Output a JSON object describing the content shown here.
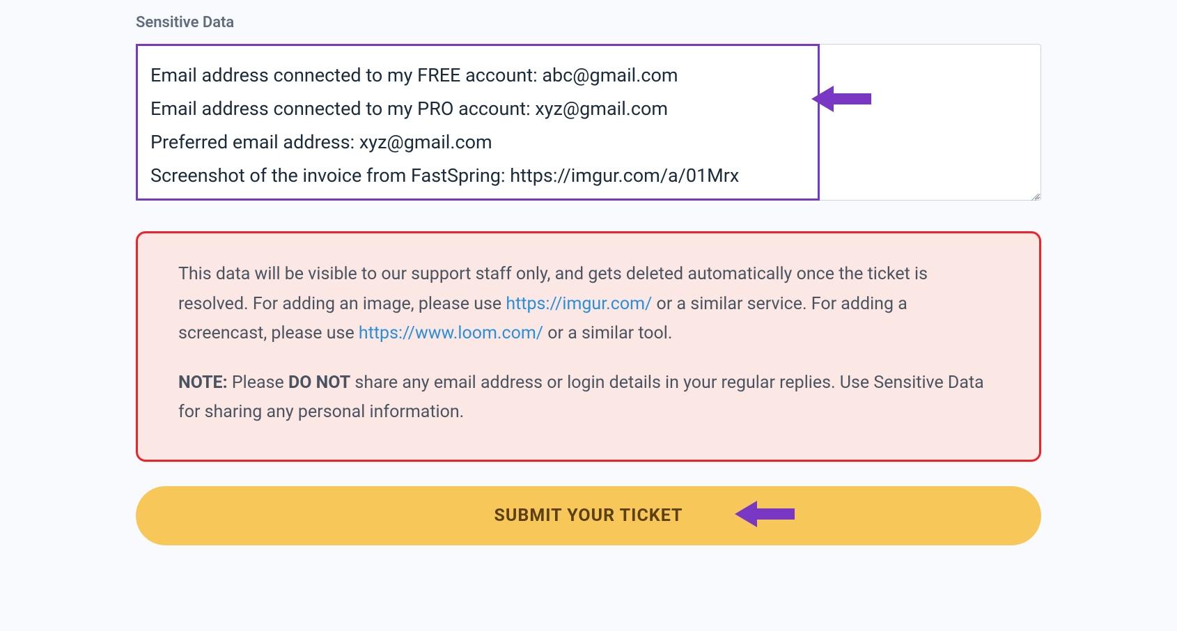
{
  "form": {
    "label": "Sensitive Data",
    "textarea_content": "Email address connected to my FREE account: abc@gmail.com\nEmail address connected to my PRO account: xyz@gmail.com\nPreferred email address: xyz@gmail.com\nScreenshot of the invoice from FastSpring: https://imgur.com/a/01Mrx",
    "lines": {
      "line1": "Email address connected to my FREE account: abc@gmail.com",
      "line2": "Email address connected to my PRO account: xyz@gmail.com",
      "line3": "Preferred email address: xyz@gmail.com",
      "line4": "Screenshot of the invoice from FastSpring: https://imgur.com/a/01Mrx"
    }
  },
  "warning": {
    "p1_part1": "This data will be visible to our support staff only, and gets deleted automatically once the ticket is resolved. For adding an image, please use ",
    "p1_link1": "https://imgur.com/",
    "p1_part2": " or a similar service. For adding a screencast, please use ",
    "p1_link2": "https://www.loom.com/",
    "p1_part3": " or a similar tool.",
    "p2_bold1": "NOTE:",
    "p2_part1": " Please ",
    "p2_bold2": "DO NOT",
    "p2_part2": " share any email address or login details in your regular replies. Use Sensitive Data for sharing any personal information."
  },
  "submit": {
    "label": "SUBMIT YOUR TICKET"
  }
}
